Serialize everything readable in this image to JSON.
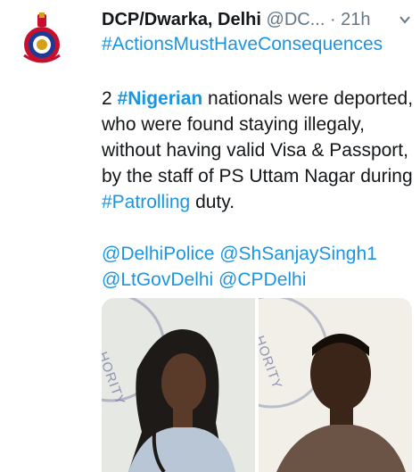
{
  "tweet": {
    "author_name": "DCP/Dwarka, Delhi",
    "author_handle": "@DC...",
    "separator": "·",
    "time": "21h",
    "hashtag_line": "#ActionsMustHaveConsequences",
    "body": {
      "p1": "2 ",
      "tag_nigerian": "#Nigerian",
      "p2": " nationals were deported, who were found staying illegaly, without having valid Visa & Passport, by the staff of PS Uttam Nagar during ",
      "tag_patrolling": "#Patrolling",
      "p3": " duty."
    },
    "mentions": [
      "@DelhiPolice",
      "@ShSanjaySingh1",
      "@LtGovDelhi",
      "@CPDelhi"
    ],
    "photo_stamp_text": [
      "HORITY",
      "HORITY"
    ]
  },
  "colors": {
    "link": "#1b95e0",
    "text": "#14171a",
    "muted": "#657786"
  },
  "icons": {
    "avatar": "delhi-police-emblem",
    "menu": "chevron-down-icon"
  }
}
